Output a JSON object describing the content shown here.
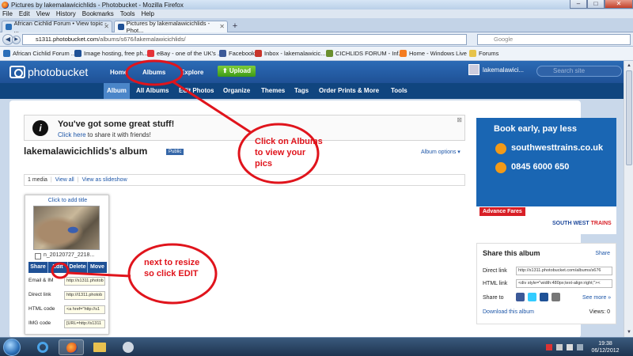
{
  "window": {
    "title": "Pictures by lakemalawicichlids - Photobucket - Mozilla Firefox"
  },
  "menu": [
    "File",
    "Edit",
    "View",
    "History",
    "Bookmarks",
    "Tools",
    "Help"
  ],
  "tabs": [
    {
      "label": "African Cichlid Forum • View topic - ..."
    },
    {
      "label": "Pictures by lakemalawicichlids - Phot..."
    }
  ],
  "nav": {
    "url_host": "s1311.photobucket.com",
    "url_path": "/albums/s676/lakemalawicichlids/",
    "url_prefix": "s1311.",
    "url_domain": "photobucket.com",
    "search_placeholder": "Google"
  },
  "bookmarks": [
    {
      "label": "African Cichlid Forum ...",
      "color": "#2b6fb8"
    },
    {
      "label": "Image hosting, free ph...",
      "color": "#1f5196"
    },
    {
      "label": "eBay - one of the UK's ...",
      "color": "#e53238"
    },
    {
      "label": "Facebook",
      "color": "#3b5998"
    },
    {
      "label": "Inbox - lakemalawicic...",
      "color": "#c8352b"
    },
    {
      "label": "CICHLIDS FORUM - Inf...",
      "color": "#6a8f2f"
    },
    {
      "label": "Home - Windows Live",
      "color": "#f47c20"
    },
    {
      "label": "Forums",
      "color": "#e7c34a"
    }
  ],
  "pb": {
    "logo": "photobucket",
    "nav": {
      "home": "Home",
      "albums": "Albums",
      "explore": "Explore",
      "upload": "Upload"
    },
    "user": "lakemalawici...",
    "search_placeholder": "Search site",
    "subnav": [
      "Album",
      "All Albums",
      "Edit Photos",
      "Organize",
      "Themes",
      "Tags",
      "Order Prints & More",
      "Tools"
    ]
  },
  "notice": {
    "heading": "You've got some great stuff!",
    "link": "Click here",
    "rest": " to share it with friends!",
    "close": "⊠"
  },
  "album": {
    "title": "lakemalawicichlids's album",
    "badge": "Public",
    "options": "Album options ▾",
    "media_count": "1 media",
    "view_all": "View all",
    "slideshow": "View as slideshow"
  },
  "photo": {
    "add_title": "Click to add title",
    "filename": "n_20120727_2218...",
    "buttons": [
      "Share",
      "Edit",
      "Delete",
      "Move"
    ],
    "fields": [
      {
        "label": "Email & IM",
        "value": "http://s1311.photob"
      },
      {
        "label": "Direct link",
        "value": "http://i1311.photob"
      },
      {
        "label": "HTML code",
        "value": "<a href=\"http://s1"
      },
      {
        "label": "IMG code",
        "value": "[URL=http://s1311"
      }
    ]
  },
  "ad": {
    "headline": "Book early, pay less",
    "line1": "southwesttrains.co.uk",
    "line2": "0845 6000 650",
    "tag": "Advance Fares",
    "brand_a": "SOUTH WEST ",
    "brand_b": "TRAINS"
  },
  "share_panel": {
    "heading": "Share this album",
    "share_link": "Share",
    "direct_label": "Direct link",
    "direct_value": "http://s1311.photobucket.com/albums/s676",
    "html_label": "HTML link",
    "html_value": "<div style=\"width:480px;text-align:right;\"><",
    "share_to": "Share to",
    "see_more": "See more »",
    "download": "Download this album",
    "views": "Views: 0"
  },
  "annotations": {
    "albums_note": [
      "Click on Albums",
      "to view your",
      "pics"
    ],
    "edit_note": [
      "next to resize",
      "so click EDIT"
    ]
  },
  "taskbar": {
    "time": "19:38",
    "date": "06/12/2012"
  },
  "colors": {
    "pb_blue": "#1f5196",
    "annotation_red": "#e0141c",
    "upload_green": "#3d9a15"
  }
}
